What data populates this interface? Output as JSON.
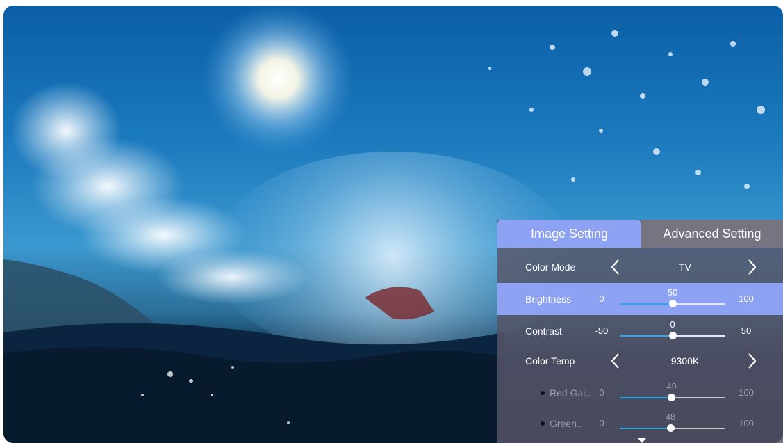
{
  "tabs": [
    {
      "label": "Image Setting",
      "active": true
    },
    {
      "label": "Advanced Setting",
      "active": false
    }
  ],
  "rows": {
    "color_mode": {
      "label": "Color Mode",
      "value": "TV"
    },
    "brightness": {
      "label": "Brightness",
      "min": "0",
      "max": "100",
      "current": "50",
      "fraction": 0.5
    },
    "contrast": {
      "label": "Contrast",
      "min": "-50",
      "max": "50",
      "current": "0",
      "fraction": 0.5
    },
    "color_temp": {
      "label": "Color Temp",
      "value": "9300K"
    },
    "red_gain": {
      "label": "Red Gai..",
      "min": "0",
      "max": "100",
      "current": "49",
      "fraction": 0.49
    },
    "green_gain": {
      "label": "Green..",
      "min": "0",
      "max": "100",
      "current": "48",
      "fraction": 0.48
    }
  },
  "icons": {
    "prev": "chevron-left-icon",
    "next": "chevron-right-icon",
    "scroll": "caret-down-icon"
  },
  "colors": {
    "accent": "#8ea2f3",
    "slider_fill": "#2fa4e7",
    "panel": "#585668"
  }
}
